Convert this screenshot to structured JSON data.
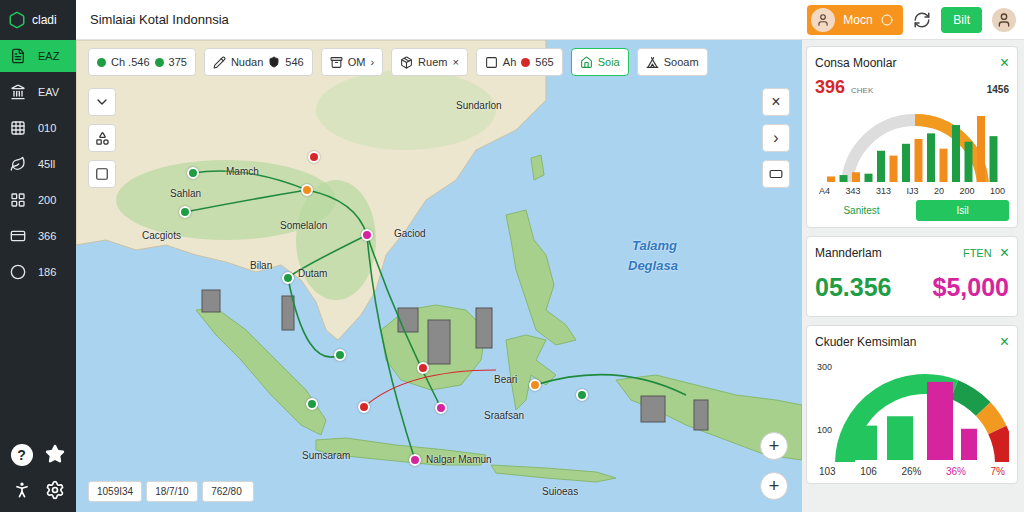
{
  "window": {
    "title": "Simlaiai Kotal Indonnsia"
  },
  "logo": {
    "text": "cladi"
  },
  "header": {
    "user_button": "Mocn",
    "action_button": "Bilt"
  },
  "sidebar": {
    "items": [
      {
        "label": "EAZ",
        "selected": true
      },
      {
        "label": "EAV",
        "selected": false
      },
      {
        "label": "010",
        "selected": false
      },
      {
        "label": "45ll",
        "selected": false
      },
      {
        "label": "200",
        "selected": false
      },
      {
        "label": "366",
        "selected": false
      },
      {
        "label": "186",
        "selected": false
      }
    ],
    "help": "?"
  },
  "map": {
    "chips": [
      {
        "label": "Ch .546",
        "value": "375",
        "trail": "",
        "selected": false
      },
      {
        "label": "Nudan",
        "value": "546",
        "trail": "",
        "selected": false
      },
      {
        "label": "OM",
        "value": "",
        "trail": "›",
        "selected": false
      },
      {
        "label": "Ruem",
        "value": "",
        "trail": "×",
        "selected": false
      },
      {
        "label": "Ah",
        "value": "565",
        "trail": "",
        "selected": false
      },
      {
        "label": "Soia",
        "value": "",
        "trail": "",
        "selected": true
      },
      {
        "label": "Sooam",
        "value": "",
        "trail": "",
        "selected": false
      }
    ],
    "labels": [
      {
        "text": "Sundarlon",
        "kind": "place"
      },
      {
        "text": "Mamch",
        "kind": "place"
      },
      {
        "text": "Sahlan",
        "kind": "place"
      },
      {
        "text": "Cacgiots",
        "kind": "place"
      },
      {
        "text": "Somelalon",
        "kind": "place"
      },
      {
        "text": "Gaciod",
        "kind": "place"
      },
      {
        "text": "Bilan",
        "kind": "place"
      },
      {
        "text": "Dutam",
        "kind": "place"
      },
      {
        "text": "Beari",
        "kind": "place"
      },
      {
        "text": "Sraafsan",
        "kind": "place"
      },
      {
        "text": "Sumsaram",
        "kind": "place"
      },
      {
        "text": "Nalgar Mamun",
        "kind": "place"
      },
      {
        "text": "Talamg",
        "kind": "sea"
      },
      {
        "text": "Deglasa",
        "kind": "sea"
      },
      {
        "text": "Suioeas",
        "kind": "place"
      }
    ],
    "pins": [
      {
        "color": "#1f9d45"
      },
      {
        "color": "#1f9d45"
      },
      {
        "color": "#f28c1c"
      },
      {
        "color": "#d62828"
      },
      {
        "color": "#d6249f"
      },
      {
        "color": "#1f9d45"
      },
      {
        "color": "#1f9d45"
      },
      {
        "color": "#1f9d45"
      },
      {
        "color": "#d62828"
      },
      {
        "color": "#d62828"
      },
      {
        "color": "#d6249f"
      },
      {
        "color": "#f28c1c"
      },
      {
        "color": "#1f9d45"
      },
      {
        "color": "#d6249f"
      }
    ],
    "controls": {
      "close": "×",
      "next": "›"
    },
    "zoom": [
      "+",
      "+"
    ],
    "coordinates": [
      "1059I34",
      "18/7/10",
      "762/80"
    ]
  },
  "panels": {
    "monitor": {
      "title": "Consa Moonlar",
      "close": "×",
      "value_left": "396",
      "tag": "CHEK",
      "value_right": "1456",
      "gauge": {
        "level": 0.5
      },
      "bars": [
        {
          "value": 8,
          "color": "#f28c1c"
        },
        {
          "value": 10,
          "color": "#1f9d45"
        },
        {
          "value": 14,
          "color": "#f28c1c"
        },
        {
          "value": 12,
          "color": "#1f9d45"
        },
        {
          "value": 45,
          "color": "#1f9d45"
        },
        {
          "value": 38,
          "color": "#f28c1c"
        },
        {
          "value": 55,
          "color": "#1f9d45"
        },
        {
          "value": 62,
          "color": "#f28c1c"
        },
        {
          "value": 70,
          "color": "#1f9d45"
        },
        {
          "value": 48,
          "color": "#f28c1c"
        },
        {
          "value": 82,
          "color": "#1f9d45"
        },
        {
          "value": 58,
          "color": "#1f9d45"
        },
        {
          "value": 95,
          "color": "#f28c1c"
        },
        {
          "value": 66,
          "color": "#1f9d45"
        }
      ],
      "x_labels": [
        "A4",
        "343",
        "313",
        "IJ3",
        "20",
        "200",
        "100"
      ],
      "buttons": [
        {
          "label": "Sanitest",
          "selected": false
        },
        {
          "label": "Isil",
          "selected": true
        }
      ]
    },
    "summary": {
      "title": "Mannderlam",
      "tag": "FTEN",
      "close": "×",
      "value": "05.356",
      "amount": "$5,000"
    },
    "status": {
      "title": "Ckuder Kemsimlan",
      "close": "×",
      "y_ticks": [
        "300",
        "100"
      ],
      "gauge": [
        {
          "share": 0.62,
          "color": "#22c55e"
        },
        {
          "share": 0.14,
          "color": "#1a9c4a"
        },
        {
          "share": 0.1,
          "color": "#f29a1f"
        },
        {
          "share": 0.14,
          "color": "#d11f1f"
        }
      ],
      "bars": [
        {
          "value": 110,
          "color": "#22c55e"
        },
        {
          "value": 140,
          "color": "#22c55e"
        },
        {
          "value": 250,
          "color": "#d6249f"
        },
        {
          "value": 100,
          "color": "#d6249f"
        }
      ],
      "x_labels": [
        {
          "text": "103",
          "color": "#333333"
        },
        {
          "text": "106",
          "color": "#333333"
        },
        {
          "text": "26%",
          "color": "#333333"
        },
        {
          "text": "36%",
          "color": "#d6249f"
        },
        {
          "text": "7%",
          "color": "#d11f1f"
        }
      ]
    }
  }
}
